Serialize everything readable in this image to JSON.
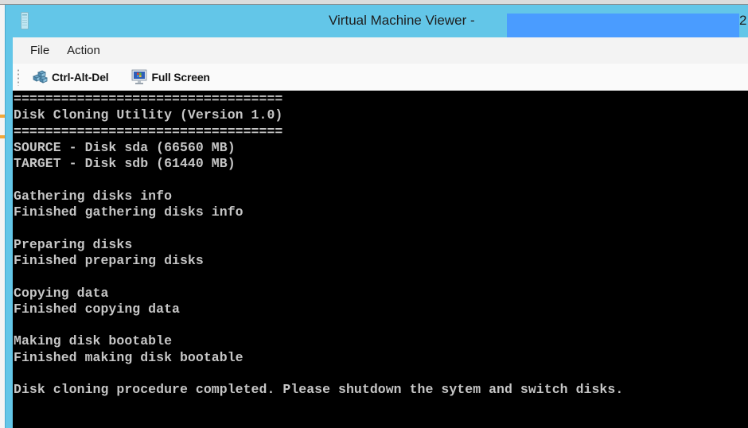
{
  "window": {
    "title": "Virtual Machine Viewer - ",
    "title_suffix": "2",
    "title_redacted": true,
    "accent_color": "#63c6e8",
    "redaction_color": "#4a9cff"
  },
  "menubar": {
    "items": [
      {
        "label": "File"
      },
      {
        "label": "Action"
      }
    ]
  },
  "toolbar": {
    "buttons": [
      {
        "label": "Ctrl-Alt-Del",
        "icon": "ctrl-alt-del-icon"
      },
      {
        "label": "Full Screen",
        "icon": "monitor-icon"
      }
    ]
  },
  "console": {
    "foreground_color": "#c6c6c6",
    "background_color": "#000000",
    "lines": [
      "==================================",
      "Disk Cloning Utility (Version 1.0)",
      "==================================",
      "SOURCE - Disk sda (66560 MB)",
      "TARGET - Disk sdb (61440 MB)",
      "",
      "Gathering disks info",
      "Finished gathering disks info",
      "",
      "Preparing disks",
      "Finished preparing disks",
      "",
      "Copying data",
      "Finished copying data",
      "",
      "Making disk bootable",
      "Finished making disk bootable",
      "",
      "Disk cloning procedure completed. Please shutdown the sytem and switch disks."
    ]
  }
}
